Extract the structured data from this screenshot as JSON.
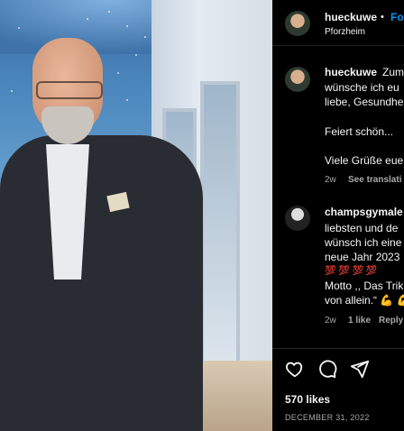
{
  "post": {
    "username": "hueckuwe",
    "separator": "•",
    "follow_label": "Fo",
    "location": "Pforzheim"
  },
  "caption": {
    "username": "hueckuwe",
    "line1": "Zum",
    "line2": "wünsche ich eu",
    "line3": "liebe, Gesundhe",
    "line4": "Feiert schön...",
    "line5": "Viele Grüße eue",
    "time": "2w",
    "see_translation": "See translati"
  },
  "comment": {
    "username": "champsgymale",
    "line1": "liebsten und de",
    "line2": "wünsch ich eine",
    "line3": "neue Jahr 2023",
    "line4": "💯 💯 💯 💯",
    "line5": "Motto ,, Das Trik",
    "line6": "von allein.“ 💪 💪",
    "time": "2w",
    "likes": "1 like",
    "reply": "Reply"
  },
  "actions": {
    "like_icon": "heart-icon",
    "comment_icon": "comment-icon",
    "share_icon": "share-icon"
  },
  "stats": {
    "likes": "570 likes",
    "date": "DECEMBER 31, 2022"
  }
}
